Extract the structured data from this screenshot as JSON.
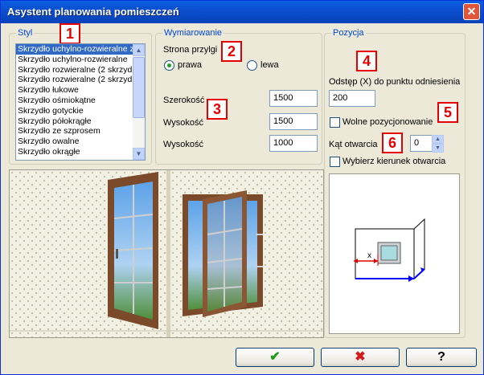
{
  "window": {
    "title": "Asystent planowania pomieszczeń",
    "close_glyph": "✕"
  },
  "styl": {
    "title": "Styl",
    "badge": "1",
    "items": [
      "Skrzydło uchylno-rozwieralne z",
      "Skrzydło uchylno-rozwieralne",
      "Skrzydło rozwieralne (2 skrzyd",
      "Skrzydło rozwieralne (2 skrzyd",
      "Skrzydło łukowe",
      "Skrzydło ośmiokątne",
      "Skrzydło gotyckie",
      "Skrzydło półokrągłe",
      "Skrzydło ze szprosem",
      "Skrzydło owalne",
      "Skrzydło okrągłe"
    ],
    "selected_index": 0
  },
  "wymiarowanie": {
    "title": "Wymiarowanie",
    "badge2": "2",
    "badge3": "3",
    "strona_label": "Strona przylgi",
    "radio_right": "prawa",
    "radio_left": "lewa",
    "selected": "prawa",
    "szerokosc_label": "Szerokość",
    "szerokosc_value": "1500",
    "wysokosc_label": "Wysokość",
    "wysokosc_value": "1500",
    "wysokosc2_label": "Wysokość",
    "wysokosc2_value": "1000"
  },
  "pozycja": {
    "title": "Pozycja",
    "badge4": "4",
    "badge5": "5",
    "badge6": "6",
    "odstep_label": "Odstęp (X) do punktu odniesienia",
    "odstep_value": "200",
    "wolne_label": "Wolne pozycjonowanie",
    "wolne_checked": false,
    "kat_label": "Kąt otwarcia",
    "kat_value": "0",
    "kierunek_label": "Wybierz kierunek otwarcia",
    "kierunek_checked": false,
    "diagram_x_label": "x"
  },
  "buttons": {
    "ok_glyph": "✔",
    "cancel_glyph": "✖",
    "help_glyph": "?"
  },
  "colors": {
    "accent": "#0046d5",
    "badge": "#e60000",
    "ok": "#1a9a1a",
    "cancel": "#d41a1a",
    "frame": "#7a4a2a"
  }
}
